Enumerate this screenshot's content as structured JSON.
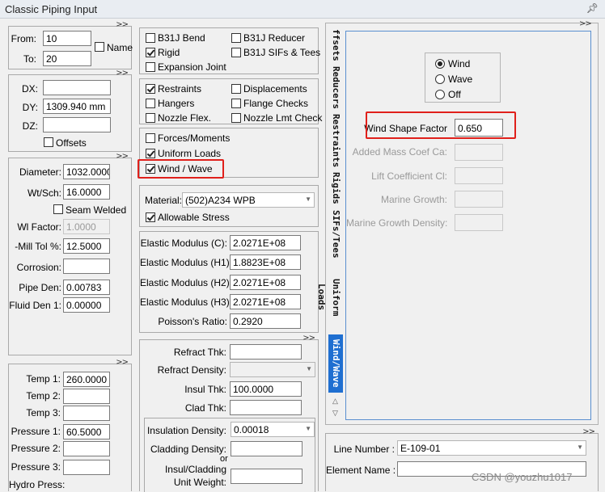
{
  "window": {
    "title": "Classic Piping Input",
    "pin_icon": "pin-icon"
  },
  "nodes": {
    "from_label": "From:",
    "from_value": "10",
    "to_label": "To:",
    "to_value": "20",
    "name_label": "Name",
    "name_checked": false
  },
  "offsets": {
    "dx_label": "DX:",
    "dx_value": "",
    "dy_label": "DY:",
    "dy_value": "1309.940 mm",
    "dz_label": "DZ:",
    "dz_value": "",
    "offsets_label": "Offsets"
  },
  "pipe": {
    "diameter_label": "Diameter:",
    "diameter_value": "1032.0000",
    "wt_label": "Wt/Sch:",
    "wt_value": "16.0000",
    "seam_label": "Seam Welded",
    "wl_label": "Wl Factor:",
    "wl_value": "1.0000",
    "mill_label": "-Mill Tol %:",
    "mill_value": "12.5000",
    "corr_label": "Corrosion:",
    "corr_value": "",
    "pipeden_label": "Pipe Den:",
    "pipeden_value": "0.00783",
    "fluid_label": "Fluid Den 1:",
    "fluid_value": "0.00000"
  },
  "temps": {
    "t1_label": "Temp 1:",
    "t1_value": "260.0000",
    "t2_label": "Temp 2:",
    "t2_value": "",
    "t3_label": "Temp 3:",
    "t3_value": "",
    "p1_label": "Pressure 1:",
    "p1_value": "60.5000",
    "p2_label": "Pressure 2:",
    "p2_value": "",
    "p3_label": "Pressure 3:",
    "p3_value": "",
    "hydro_label": "Hydro Press:"
  },
  "checks": {
    "b31j_bend": "B31J Bend",
    "b31j_reducer": "B31J Reducer",
    "rigid": "Rigid",
    "b31j_sifs": "B31J SIFs & Tees",
    "expansion": "Expansion Joint",
    "restraints": "Restraints",
    "displacements": "Displacements",
    "hangers": "Hangers",
    "flange": "Flange Checks",
    "nozzle_flex": "Nozzle Flex.",
    "nozzle_lmt": "Nozzle Lmt Check",
    "forces": "Forces/Moments",
    "uniform": "Uniform Loads",
    "wind_wave": "Wind / Wave"
  },
  "material": {
    "label": "Material:",
    "value": "(502)A234 WPB",
    "allowable": "Allowable Stress"
  },
  "elastic": {
    "e_c_label": "Elastic Modulus (C):",
    "e_c_value": "2.0271E+08",
    "e_h1_label": "Elastic Modulus (H1):",
    "e_h1_value": "1.8823E+08",
    "e_h2_label": "Elastic Modulus (H2):",
    "e_h2_value": "2.0271E+08",
    "e_h3_label": "Elastic Modulus (H3):",
    "e_h3_value": "2.0271E+08",
    "poisson_label": "Poisson's Ratio:",
    "poisson_value": "0.2920"
  },
  "insulation": {
    "refract_thk_label": "Refract Thk:",
    "refract_thk_value": "",
    "refract_den_label": "Refract Density:",
    "insul_thk_label": "Insul Thk:",
    "insul_thk_value": "100.0000",
    "clad_thk_label": "Clad Thk:",
    "clad_thk_value": "",
    "insul_den_label": "Insulation Density:",
    "insul_den_value": "0.00018",
    "clad_den_label": "Cladding Density:",
    "or_label": "or",
    "insul_clad_label1": "Insul/Cladding",
    "insul_clad_label2": "Unit Weight:"
  },
  "tabs": [
    "ffsets",
    "Reducers",
    "Restraints",
    "Rigids",
    "SIFs/Tees",
    "Uniform Loads",
    "Wind/Wave"
  ],
  "windwave": {
    "opt_wind": "Wind",
    "opt_wave": "Wave",
    "opt_off": "Off",
    "shape_label": "Wind Shape Factor",
    "shape_value": "0.650",
    "added_mass_label": "Added Mass Coef Ca:",
    "lift_label": "Lift Coefficient Cl:",
    "marine_label": "Marine Growth:",
    "marine_den_label": "Marine Growth Density:"
  },
  "bottom": {
    "line_label": "Line Number :",
    "line_value": "E-109-01",
    "element_label": "Element Name :",
    "element_value": ""
  },
  "watermark": "CSDN @youzhu1017",
  "colors": {
    "highlight": "#e0201b",
    "active_tab": "#1f6fd1"
  }
}
